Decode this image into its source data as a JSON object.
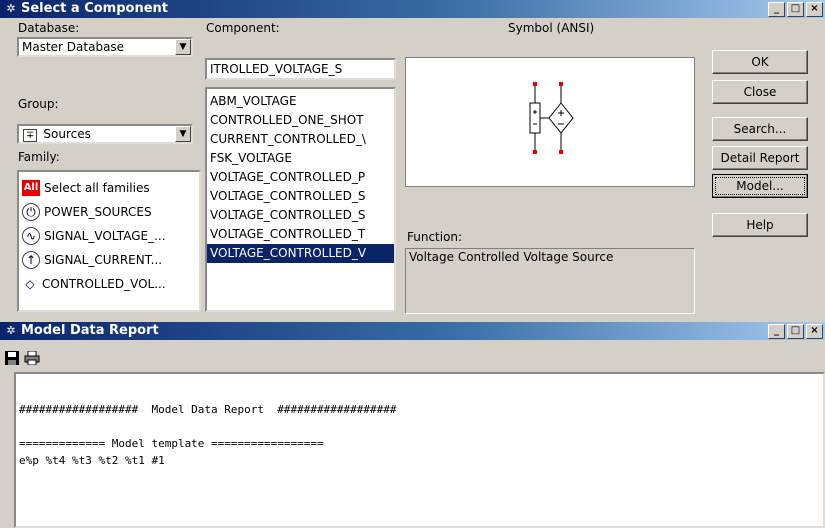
{
  "component_window": {
    "title": "Select a Component",
    "database_label": "Database:",
    "database_value": "Master Database",
    "component_label": "Component:",
    "component_value": "ITROLLED_VOLTAGE_S",
    "symbol_label": "Symbol (ANSI)",
    "group_label": "Group:",
    "group_value": "Sources",
    "family_label": "Family:",
    "families": [
      {
        "label": "Select all families",
        "icon": "all-families-icon",
        "glyph": "All"
      },
      {
        "label": "POWER_SOURCES",
        "icon": "power-sources-icon",
        "glyph": "⏻"
      },
      {
        "label": "SIGNAL_VOLTAGE_...",
        "icon": "signal-voltage-icon",
        "glyph": "∿"
      },
      {
        "label": "SIGNAL_CURRENT...",
        "icon": "signal-current-icon",
        "glyph": "↑"
      },
      {
        "label": "CONTROLLED_VOL...",
        "icon": "controlled-voltage-icon",
        "glyph": "◇"
      }
    ],
    "components": [
      "ABM_VOLTAGE",
      "CONTROLLED_ONE_SHOT",
      "CURRENT_CONTROLLED_\\",
      "FSK_VOLTAGE",
      "VOLTAGE_CONTROLLED_P",
      "VOLTAGE_CONTROLLED_S",
      "VOLTAGE_CONTROLLED_S",
      "VOLTAGE_CONTROLLED_T",
      "VOLTAGE_CONTROLLED_V"
    ],
    "selected_component_index": 8,
    "function_label": "Function:",
    "function_value": "Voltage Controlled Voltage Source",
    "buttons": {
      "ok": "OK",
      "close": "Close",
      "search": "Search...",
      "detail_report": "Detail Report",
      "model": "Model...",
      "help": "Help"
    }
  },
  "report_window": {
    "title": "Model Data Report",
    "toolbar": {
      "save_icon": "save-icon",
      "print_icon": "print-icon"
    },
    "lines": [
      "##################  Model Data Report  ##################",
      "",
      "============= Model template =================",
      "e%p %t4 %t3 %t2 %t1 #1"
    ]
  },
  "window_controls": {
    "minimize": "_",
    "maximize": "□",
    "close": "×"
  },
  "colors": {
    "title_active": "#0a246a",
    "selection": "#0a246a",
    "face": "#d4d0c8"
  }
}
